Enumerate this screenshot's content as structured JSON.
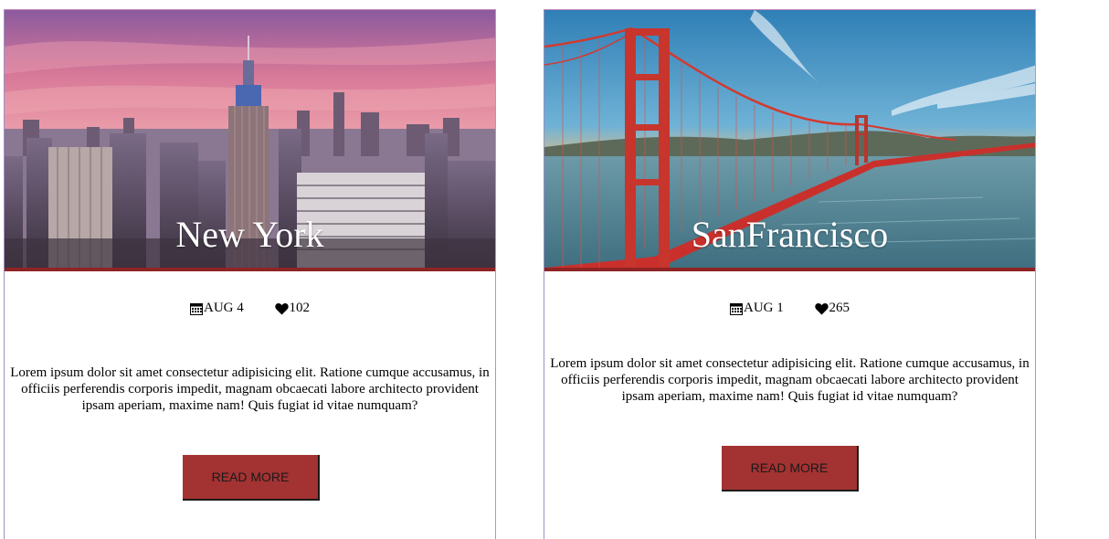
{
  "cards": [
    {
      "city": "New York",
      "date": "AUG 4",
      "likes": "102",
      "description": "Lorem ipsum dolor sit amet consectetur adipisicing elit. Ratione cumque accusamus, in officiis perferendis corporis impedit, magnam obcaecati labore architecto provident ipsam aperiam, maxime nam! Quis fugiat id vitae numquam?",
      "button_label": "READ MORE",
      "image": "city-skyline-photo"
    },
    {
      "city": "SanFrancisco",
      "date": "AUG 1",
      "likes": "265",
      "description": "Lorem ipsum dolor sit amet consectetur adipisicing elit. Ratione cumque accusamus, in officiis perferendis corporis impedit, magnam obcaecati labore architecto provident ipsam aperiam, maxime nam! Quis fugiat id vitae numquam?",
      "button_label": "READ MORE",
      "image": "golden-gate-bridge-photo"
    }
  ],
  "icons": {
    "date": "calendar-icon",
    "likes": "heart-icon"
  },
  "colors": {
    "accent": "#a33232",
    "hero_border": "#8f2424",
    "card_border": "#c98ab8"
  }
}
